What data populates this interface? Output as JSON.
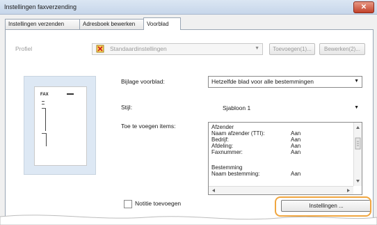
{
  "window": {
    "title": "Instellingen faxverzending",
    "close_glyph": "✕"
  },
  "tabs": [
    "Instellingen verzenden",
    "Adresboek bewerken",
    "Voorblad"
  ],
  "profile": {
    "label": "Profiel",
    "value": "Standaardinstellingen",
    "add_button": "Toevoegen(1)...",
    "edit_button": "Bewerken(2)..."
  },
  "preview": {
    "sheet_label": "FAX"
  },
  "cover_sheet": {
    "label": "Bijlage voorblad:",
    "value": "Hetzelfde blad voor alle bestemmingen"
  },
  "style": {
    "label": "Stijl:",
    "value": "Sjabloon 1"
  },
  "items": {
    "label": "Toe te voegen items:",
    "rows": [
      {
        "name": "Afzender",
        "value": ""
      },
      {
        "name": "Naam afzender (TTI):",
        "value": "Aan"
      },
      {
        "name": "Bedrijf:",
        "value": "Aan"
      },
      {
        "name": "Afdeling:",
        "value": "Aan"
      },
      {
        "name": "Faxnummer:",
        "value": "Aan"
      },
      {
        "name": "",
        "value": ""
      },
      {
        "name": "Bestemming",
        "value": ""
      },
      {
        "name": "Naam bestemming:",
        "value": "Aan"
      }
    ]
  },
  "settings_button": "Instellingen ...",
  "notes_checkbox": "Notitie toevoegen",
  "colors": {
    "highlight": "#f0a640",
    "preview_bg": "#dde8f4",
    "title_close": "#c2412a"
  }
}
